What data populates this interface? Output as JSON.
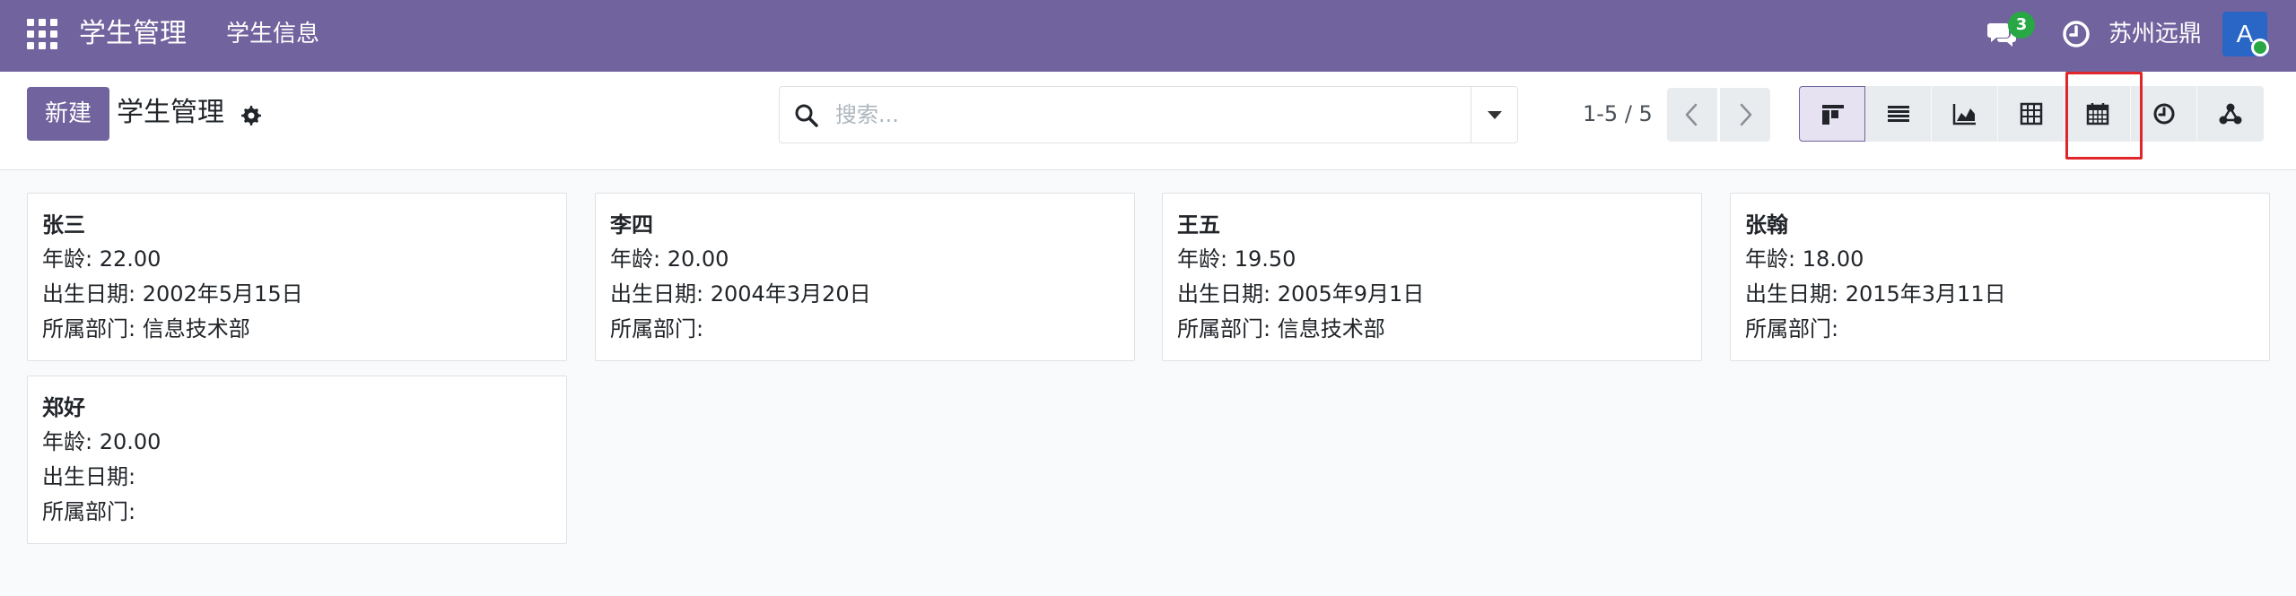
{
  "navbar": {
    "app_name": "学生管理",
    "menu_item": "学生信息",
    "chat_count": "3",
    "company": "苏州远鼎",
    "avatar_letter": "A"
  },
  "control_panel": {
    "new_button": "新建",
    "title": "学生管理",
    "search_placeholder": "搜索...",
    "pager": "1-5 / 5"
  },
  "view_switcher": [
    {
      "name": "kanban-view-icon",
      "active": true
    },
    {
      "name": "list-view-icon",
      "active": false
    },
    {
      "name": "graph-view-icon",
      "active": false
    },
    {
      "name": "pivot-view-icon",
      "active": false
    },
    {
      "name": "calendar-view-icon",
      "active": false
    },
    {
      "name": "activity-view-icon",
      "active": false
    },
    {
      "name": "hierarchy-view-icon",
      "active": false
    }
  ],
  "cards": [
    {
      "name": "张三",
      "age": "年龄: 22.00",
      "birth": "出生日期: 2002年5月15日",
      "dept": "所属部门: 信息技术部"
    },
    {
      "name": "李四",
      "age": "年龄: 20.00",
      "birth": "出生日期: 2004年3月20日",
      "dept": "所属部门:"
    },
    {
      "name": "王五",
      "age": "年龄: 19.50",
      "birth": "出生日期: 2005年9月1日",
      "dept": "所属部门: 信息技术部"
    },
    {
      "name": "张翰",
      "age": "年龄: 18.00",
      "birth": "出生日期: 2015年3月11日",
      "dept": "所属部门:"
    },
    {
      "name": "郑好",
      "age": "年龄: 20.00",
      "birth": "出生日期:",
      "dept": "所属部门:"
    }
  ],
  "colors": {
    "brand": "#71639e",
    "highlight": "#e0262b",
    "badge": "#28a745",
    "avatar": "#2a66c6"
  }
}
